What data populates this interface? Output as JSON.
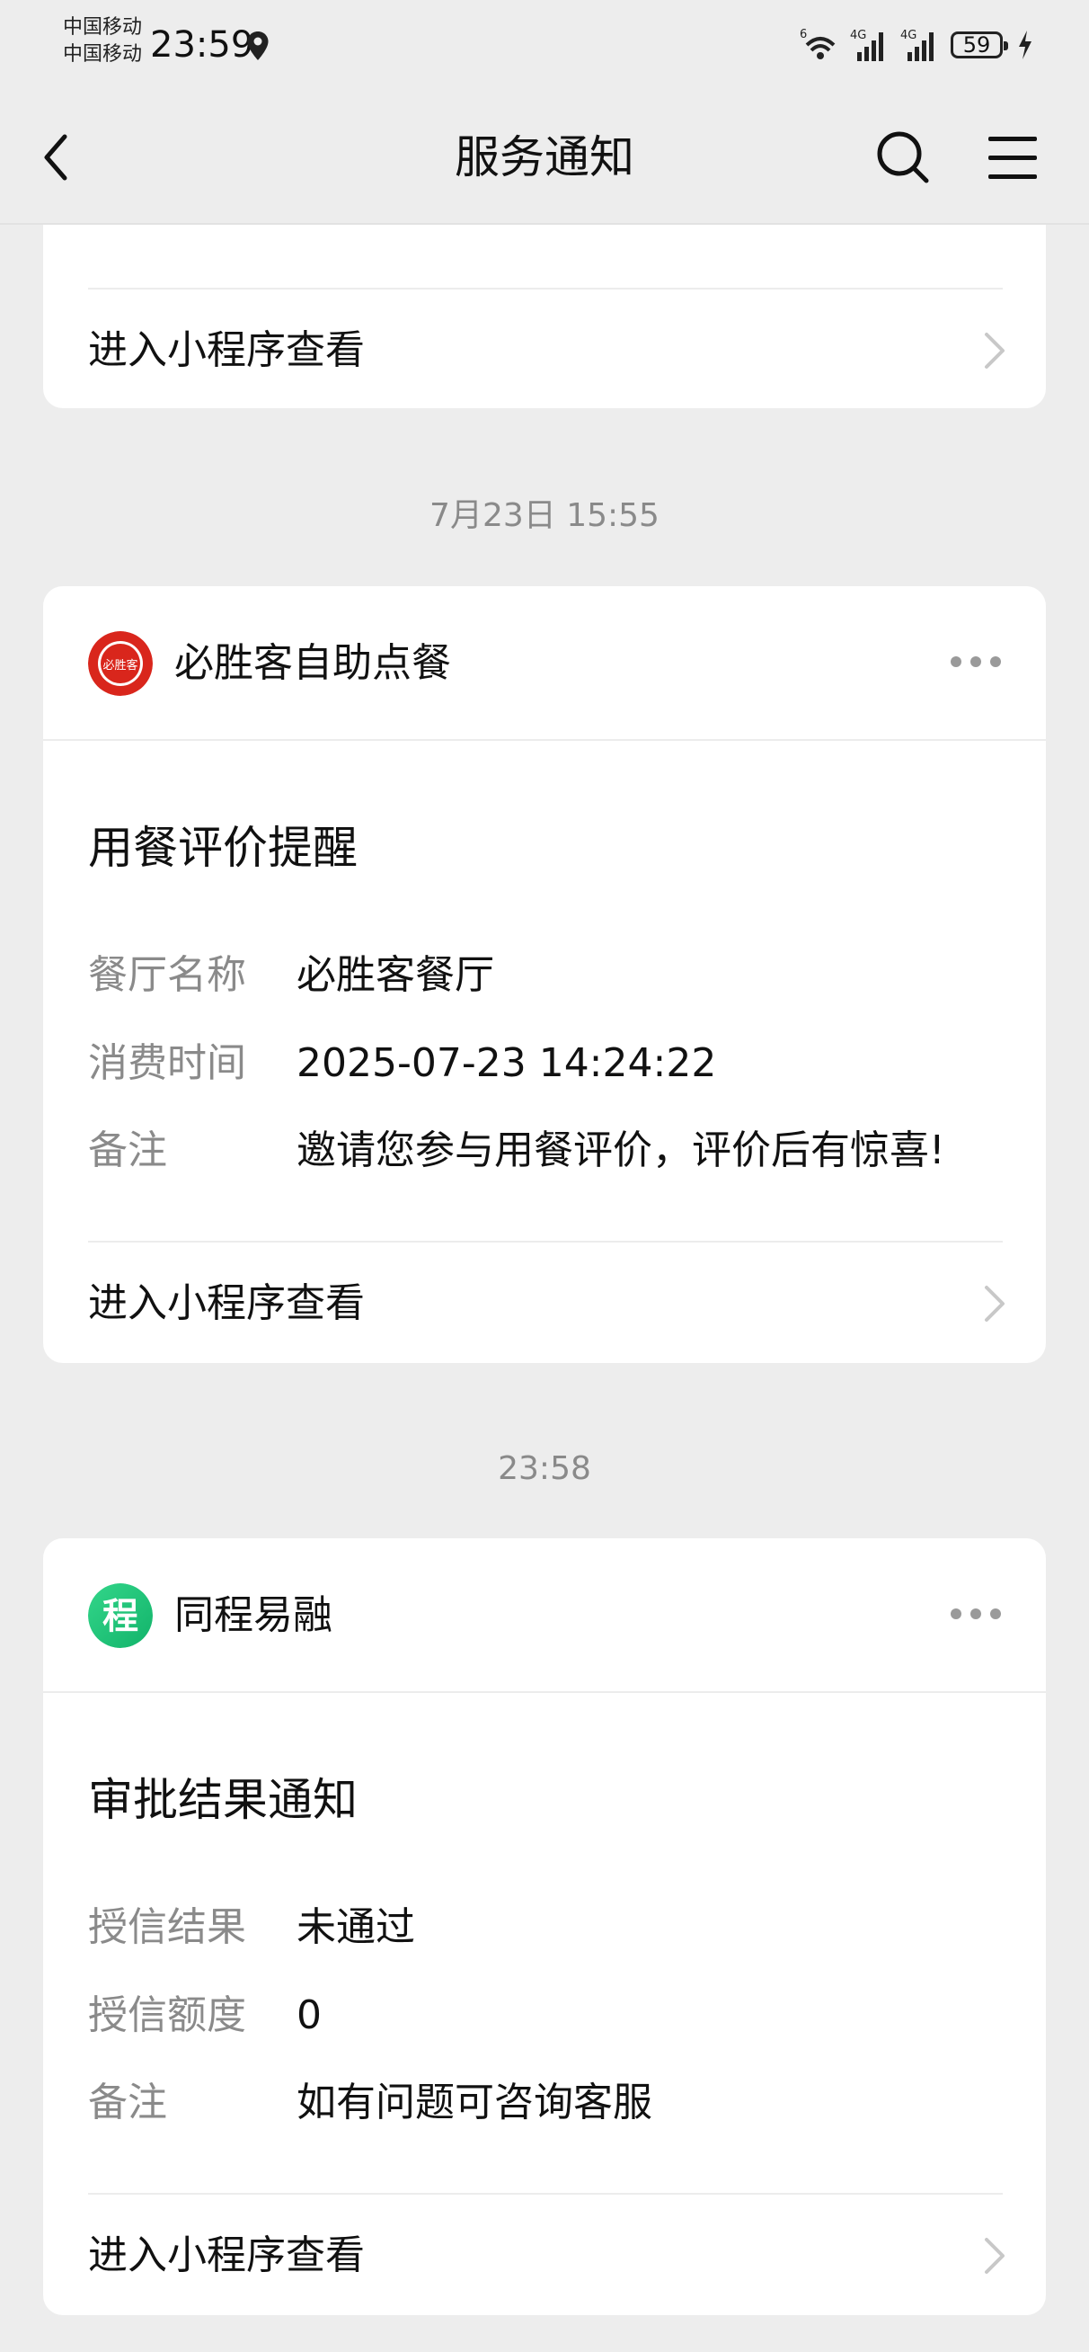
{
  "status_bar": {
    "carrier1": "中国移动",
    "carrier2": "中国移动",
    "time": "23:59",
    "battery": "59",
    "signal_label_wifi": "6",
    "signal_label_1": "4G",
    "signal_label_2": "4G"
  },
  "nav": {
    "title": "服务通知"
  },
  "top_card": {
    "enter_label": "进入小程序查看"
  },
  "timestamps": [
    "7月23日 15:55",
    "23:58"
  ],
  "cards": [
    {
      "app_name": "必胜客自助点餐",
      "logo_text": "必胜客",
      "logo_color": "#d9261c",
      "title": "用餐评价提醒",
      "rows": [
        {
          "key": "餐厅名称",
          "value": "必胜客餐厅"
        },
        {
          "key": "消费时间",
          "value": "2025-07-23 14:24:22"
        },
        {
          "key": "备注",
          "value": "邀请您参与用餐评价，评价后有惊喜!"
        }
      ],
      "enter_label": "进入小程序查看"
    },
    {
      "app_name": "同程易融",
      "logo_text": "程",
      "logo_color": "#22c17a",
      "title": "审批结果通知",
      "rows": [
        {
          "key": "授信结果",
          "value": "未通过"
        },
        {
          "key": "授信额度",
          "value": "0"
        },
        {
          "key": "备注",
          "value": "如有问题可咨询客服"
        }
      ],
      "enter_label": "进入小程序查看"
    }
  ]
}
